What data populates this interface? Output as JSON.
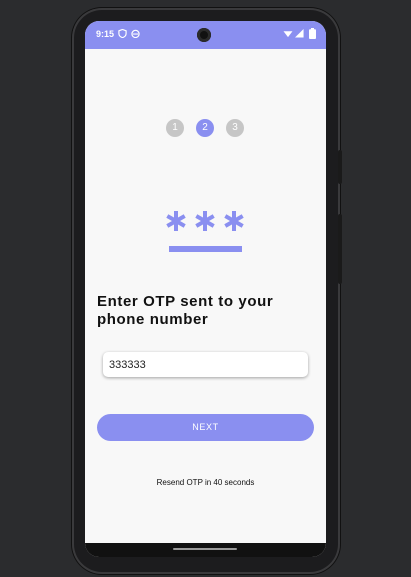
{
  "status_bar": {
    "time": "9:15",
    "icons": [
      "shield-icon",
      "android-icon",
      "wifi-icon",
      "signal-icon",
      "battery-icon"
    ]
  },
  "stepper": {
    "steps": [
      "1",
      "2",
      "3"
    ],
    "active_index": 1
  },
  "illustration": {
    "icon": "password-asterisks-icon"
  },
  "heading": "Enter OTP sent to your phone number",
  "otp_input": {
    "value": "333333"
  },
  "next_button": {
    "label": "NEXT"
  },
  "resend_text": "Resend OTP in 40 seconds",
  "colors": {
    "accent": "#8a8ff0",
    "inactive_step": "#c6c6c6",
    "background": "#f8f8f8",
    "text": "#111111"
  }
}
